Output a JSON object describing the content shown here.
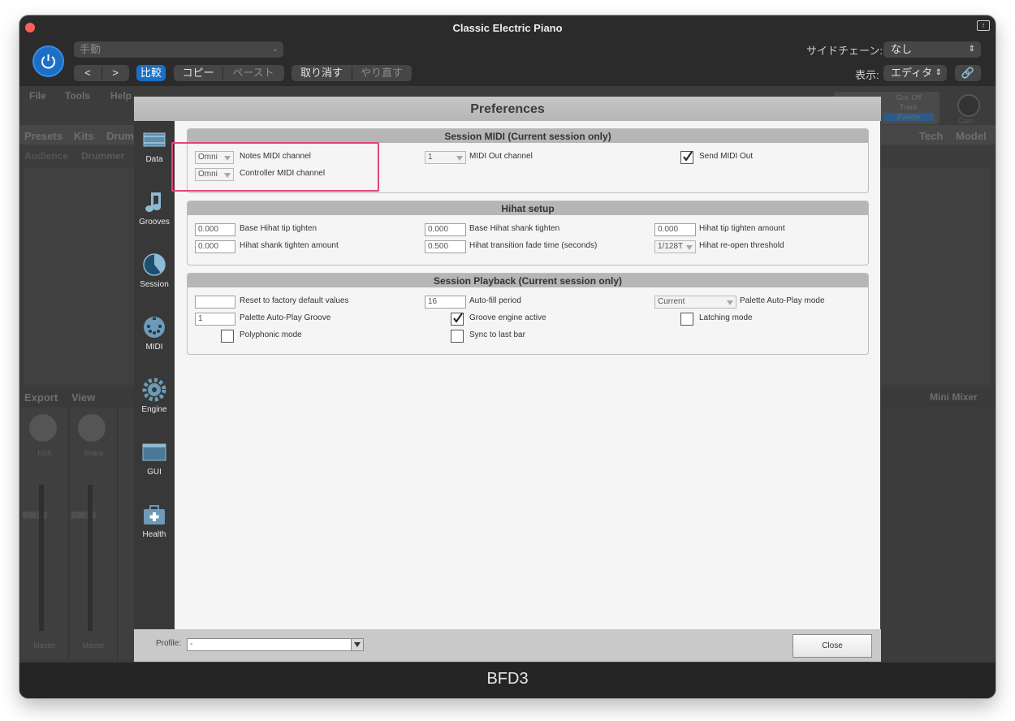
{
  "window": {
    "title": "Classic Electric Piano",
    "footer_label": "BFD3"
  },
  "host_toolbar": {
    "preset_value": "手動",
    "back_label": "<",
    "forward_label": ">",
    "compare_label": "比較",
    "copy_label": "コピー",
    "paste_label": "ペースト",
    "undo_label": "取り消す",
    "redo_label": "やり直す",
    "sidechain_label": "サイドチェーン:",
    "sidechain_value": "なし",
    "view_label": "表示:",
    "view_value": "エディタ"
  },
  "plugin_background": {
    "menu": [
      "File",
      "Tools",
      "Help"
    ],
    "tabs": [
      "Presets",
      "Kits",
      "Drum"
    ],
    "subtabs": [
      "Audience",
      "Drummer"
    ],
    "right_tabs": [
      "Tech",
      "Model"
    ],
    "export_label": "Export",
    "view_label": "View",
    "mini_mixer_label": "Mini Mixer",
    "grv_off": "Grv. Off",
    "track": "Track",
    "palette": "Palette",
    "gain": "Gain",
    "channels": [
      {
        "name": "Kick",
        "level": "0.00",
        "bus": "Master"
      },
      {
        "name": "Snare",
        "level": "0.00",
        "bus": "Master"
      }
    ]
  },
  "dialog": {
    "title": "Preferences",
    "sidebar": [
      {
        "label": "Data",
        "icon": "data-icon"
      },
      {
        "label": "Grooves",
        "icon": "music-note-icon"
      },
      {
        "label": "Session",
        "icon": "session-pie-icon"
      },
      {
        "label": "MIDI",
        "icon": "midi-connector-icon"
      },
      {
        "label": "Engine",
        "icon": "engine-gear-icon"
      },
      {
        "label": "GUI",
        "icon": "gui-window-icon"
      },
      {
        "label": "Health",
        "icon": "health-kit-icon"
      }
    ],
    "session_midi": {
      "header": "Session MIDI (Current session only)",
      "notes_channel_value": "Omni",
      "notes_channel_label": "Notes MIDI channel",
      "controller_channel_value": "Omni",
      "controller_channel_label": "Controller MIDI channel",
      "midi_out_channel_value": "1",
      "midi_out_channel_label": "MIDI Out channel",
      "send_midi_out_label": "Send MIDI Out",
      "send_midi_out_checked": true
    },
    "hihat": {
      "header": "Hihat setup",
      "base_tip_value": "0.000",
      "base_tip_label": "Base Hihat tip tighten",
      "base_shank_value": "0.000",
      "base_shank_label": "Base Hihat shank tighten",
      "tip_amount_value": "0.000",
      "tip_amount_label": "Hihat tip tighten amount",
      "shank_amount_value": "0.000",
      "shank_amount_label": "Hihat shank tighten amount",
      "fade_time_value": "0.500",
      "fade_time_label": "Hihat transition fade time (seconds)",
      "reopen_value": "1/128T",
      "reopen_label": "Hihat re-open threshold"
    },
    "playback": {
      "header": "Session Playback (Current session only)",
      "reset_value": "",
      "reset_label": "Reset to factory default values",
      "autofill_value": "16",
      "autofill_label": "Auto-fill period",
      "autoplay_mode_value": "Current",
      "autoplay_mode_label": "Palette Auto-Play mode",
      "autoplay_groove_value": "1",
      "autoplay_groove_label": "Palette Auto-Play Groove",
      "groove_engine_label": "Groove engine active",
      "groove_engine_checked": true,
      "latching_label": "Latching mode",
      "latching_checked": false,
      "polyphonic_label": "Polyphonic mode",
      "polyphonic_checked": false,
      "sync_label": "Sync to last bar",
      "sync_checked": false
    },
    "profile_label": "Profile:",
    "profile_value": "-",
    "close_label": "Close"
  },
  "colors": {
    "accent_blue": "#1b6fc4",
    "highlight_pink": "#e0457b"
  }
}
